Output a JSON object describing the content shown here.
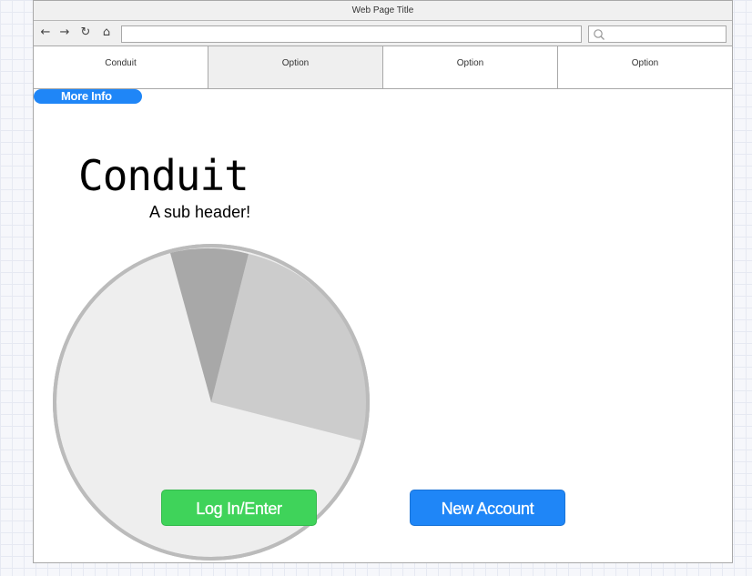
{
  "window": {
    "title": "Web Page Title"
  },
  "toolbar": {
    "icons": [
      "arrow-left-icon",
      "arrow-right-icon",
      "reload-icon",
      "home-icon"
    ],
    "url_value": "",
    "search_value": ""
  },
  "tabs": [
    {
      "label": "Conduit"
    },
    {
      "label": "Option"
    },
    {
      "label": "Option"
    },
    {
      "label": "Option"
    }
  ],
  "more_info": {
    "label": "More Info"
  },
  "hero": {
    "title": "Conduit",
    "subtitle": "A sub header!"
  },
  "pie": {
    "colors": {
      "background": "#eeeeee",
      "slice_large": "#cccccc",
      "slice_small": "#a8a8a8",
      "border": "#bbbbbb"
    }
  },
  "buttons": {
    "login": "Log In/Enter",
    "new_account": "New Account"
  },
  "colors": {
    "green": "#3fd35a",
    "blue": "#1f86f7"
  }
}
